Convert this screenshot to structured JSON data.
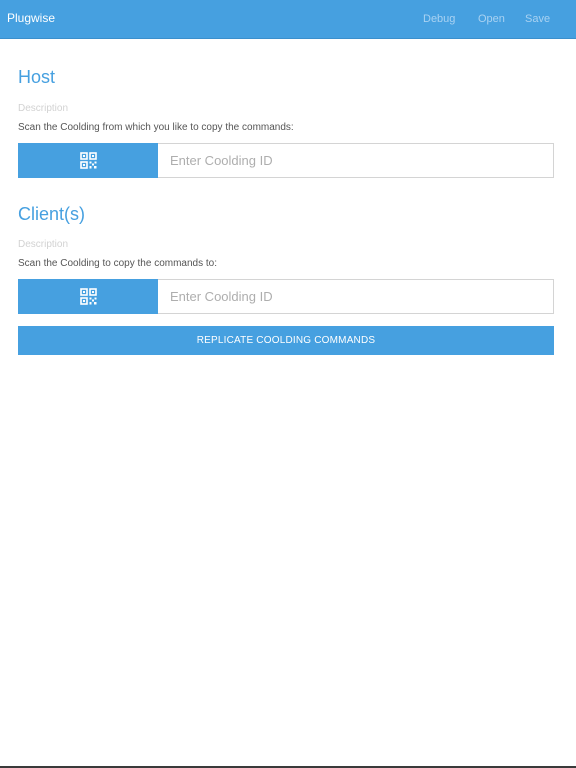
{
  "header": {
    "title": "Plugwise",
    "nav": {
      "debug": "Debug",
      "open": "Open",
      "save": "Save"
    }
  },
  "host": {
    "title": "Host",
    "description_label": "Description",
    "instruction": "Scan the Coolding from which you like to copy the commands:",
    "scan_icon": "qr-code-icon",
    "input_placeholder": "Enter Coolding ID",
    "input_value": ""
  },
  "clients": {
    "title": "Client(s)",
    "description_label": "Description",
    "instruction": "Scan the Coolding to copy the commands to:",
    "scan_icon": "qr-code-icon",
    "input_placeholder": "Enter Coolding ID",
    "input_value": ""
  },
  "actions": {
    "replicate_label": "REPLICATE COOLDING COMMANDS"
  },
  "colors": {
    "accent": "#46a0e0",
    "nav_text": "#a9d2f2",
    "placeholder": "#aeaeae",
    "description": "#d2d2d2"
  }
}
